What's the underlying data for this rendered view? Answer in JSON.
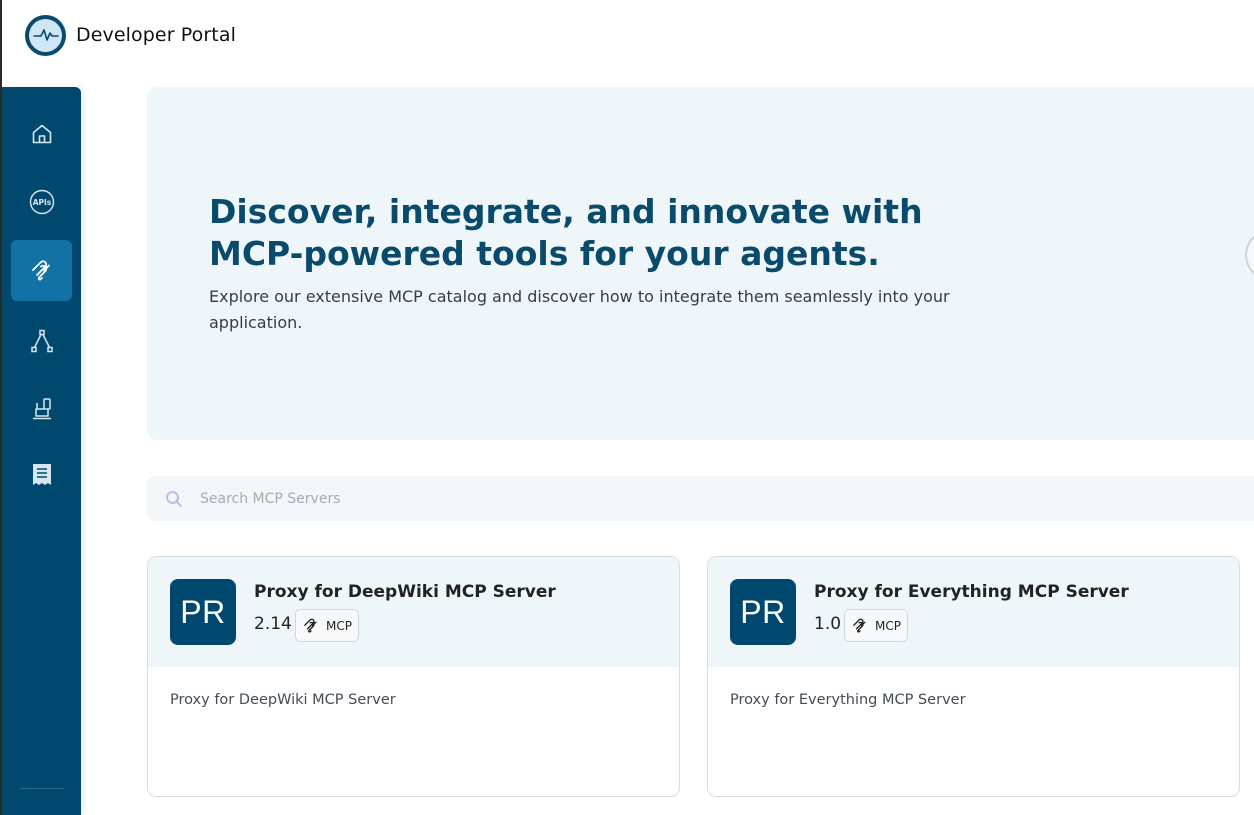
{
  "header": {
    "brand": "Developer Portal"
  },
  "sidebar": {
    "items": [
      {
        "id": "home",
        "icon": "home-icon",
        "active": false
      },
      {
        "id": "apis",
        "icon": "apis-icon",
        "label": "APIs",
        "active": false
      },
      {
        "id": "mcp",
        "icon": "mcp-icon",
        "active": true
      },
      {
        "id": "flows",
        "icon": "flow-icon",
        "active": false
      },
      {
        "id": "apps",
        "icon": "applications-icon",
        "active": false
      },
      {
        "id": "docs",
        "icon": "document-icon",
        "active": false
      }
    ]
  },
  "hero": {
    "title_line1": "Discover, integrate, and innovate with",
    "title_line2": "MCP-powered tools for your agents.",
    "subtitle": "Explore our extensive MCP catalog and discover how to integrate them seamlessly into your application."
  },
  "search": {
    "placeholder": "Search MCP Servers",
    "value": ""
  },
  "cards": [
    {
      "avatar": "PR",
      "title": "Proxy for DeepWiki MCP Server",
      "version": "2.14",
      "badge": "MCP",
      "description": "Proxy for DeepWiki MCP Server"
    },
    {
      "avatar": "PR",
      "title": "Proxy for Everything MCP Server",
      "version": "1.0",
      "badge": "MCP",
      "description": "Proxy for Everything MCP Server"
    }
  ],
  "colors": {
    "primary": "#00486e",
    "active": "#1271a5",
    "hero_bg": "#eff6fa",
    "title": "#0a4b6c"
  }
}
